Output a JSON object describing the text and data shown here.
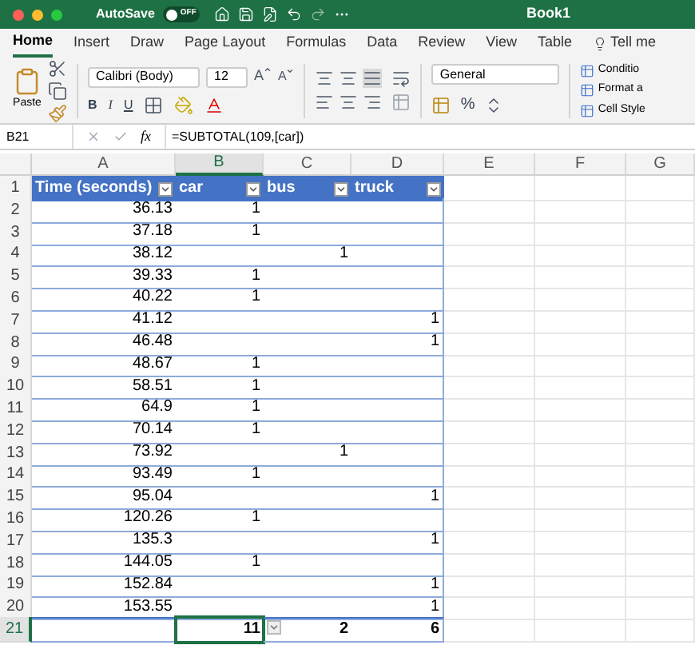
{
  "window": {
    "title": "Book1",
    "autosave": {
      "label": "AutoSave",
      "on": false,
      "state_label": "OFF"
    }
  },
  "tabs": [
    {
      "label": "Home",
      "selected": true,
      "kind": "normal"
    },
    {
      "label": "Insert",
      "selected": false,
      "kind": "normal"
    },
    {
      "label": "Draw",
      "selected": false,
      "kind": "normal"
    },
    {
      "label": "Page Layout",
      "selected": false,
      "kind": "normal"
    },
    {
      "label": "Formulas",
      "selected": false,
      "kind": "normal"
    },
    {
      "label": "Data",
      "selected": false,
      "kind": "normal"
    },
    {
      "label": "Review",
      "selected": false,
      "kind": "normal"
    },
    {
      "label": "View",
      "selected": false,
      "kind": "normal"
    },
    {
      "label": "Table",
      "selected": false,
      "kind": "contextual"
    },
    {
      "label": "Tell me",
      "selected": false,
      "kind": "search"
    }
  ],
  "ribbon": {
    "paste_label": "Paste",
    "font": "Calibri (Body)",
    "font_size": "12",
    "font_size_buttons": [
      "A",
      "A"
    ],
    "text_buttons": [
      "B",
      "I",
      "U"
    ],
    "number_format": "General",
    "percent": "%",
    "style_buttons": [
      "Conditio",
      "Format a",
      "Cell Style"
    ]
  },
  "formula_bar": {
    "name_box": "B21",
    "fx": "fx",
    "formula": "=SUBTOTAL(109,[car])"
  },
  "columns": [
    {
      "label": "A",
      "selected": false
    },
    {
      "label": "B",
      "selected": true
    },
    {
      "label": "C",
      "selected": false
    },
    {
      "label": "D",
      "selected": false
    },
    {
      "label": "E",
      "selected": false
    },
    {
      "label": "F",
      "selected": false
    },
    {
      "label": "G",
      "selected": false
    }
  ],
  "rows": [
    {
      "number": "1",
      "kind": "header",
      "selected": false,
      "cells": {
        "a": "Time (seconds)",
        "b": "car",
        "c": "bus",
        "d": "truck"
      }
    },
    {
      "number": "2",
      "kind": "data",
      "selected": false,
      "cells": {
        "a": "36.13",
        "b": "1"
      }
    },
    {
      "number": "3",
      "kind": "data",
      "selected": false,
      "cells": {
        "a": "37.18",
        "b": "1"
      }
    },
    {
      "number": "4",
      "kind": "data",
      "selected": false,
      "cells": {
        "a": "38.12",
        "c": "1"
      }
    },
    {
      "number": "5",
      "kind": "data",
      "selected": false,
      "cells": {
        "a": "39.33",
        "b": "1"
      }
    },
    {
      "number": "6",
      "kind": "data",
      "selected": false,
      "cells": {
        "a": "40.22",
        "b": "1"
      }
    },
    {
      "number": "7",
      "kind": "data",
      "selected": false,
      "cells": {
        "a": "41.12",
        "d": "1"
      }
    },
    {
      "number": "8",
      "kind": "data",
      "selected": false,
      "cells": {
        "a": "46.48",
        "d": "1"
      }
    },
    {
      "number": "9",
      "kind": "data",
      "selected": false,
      "cells": {
        "a": "48.67",
        "b": "1"
      }
    },
    {
      "number": "10",
      "kind": "data",
      "selected": false,
      "cells": {
        "a": "58.51",
        "b": "1"
      }
    },
    {
      "number": "11",
      "kind": "data",
      "selected": false,
      "cells": {
        "a": "64.9",
        "b": "1"
      }
    },
    {
      "number": "12",
      "kind": "data",
      "selected": false,
      "cells": {
        "a": "70.14",
        "b": "1"
      }
    },
    {
      "number": "13",
      "kind": "data",
      "selected": false,
      "cells": {
        "a": "73.92",
        "c": "1"
      }
    },
    {
      "number": "14",
      "kind": "data",
      "selected": false,
      "cells": {
        "a": "93.49",
        "b": "1"
      }
    },
    {
      "number": "15",
      "kind": "data",
      "selected": false,
      "cells": {
        "a": "95.04",
        "d": "1"
      }
    },
    {
      "number": "16",
      "kind": "data",
      "selected": false,
      "cells": {
        "a": "120.26",
        "b": "1"
      }
    },
    {
      "number": "17",
      "kind": "data",
      "selected": false,
      "cells": {
        "a": "135.3",
        "d": "1"
      }
    },
    {
      "number": "18",
      "kind": "data",
      "selected": false,
      "cells": {
        "a": "144.05",
        "b": "1"
      }
    },
    {
      "number": "19",
      "kind": "data",
      "selected": false,
      "cells": {
        "a": "152.84",
        "d": "1"
      }
    },
    {
      "number": "20",
      "kind": "data",
      "selected": false,
      "cells": {
        "a": "153.55",
        "d": "1"
      }
    },
    {
      "number": "21",
      "kind": "total",
      "selected": true,
      "cells": {
        "b": "11",
        "c": "2",
        "d": "6"
      }
    }
  ]
}
